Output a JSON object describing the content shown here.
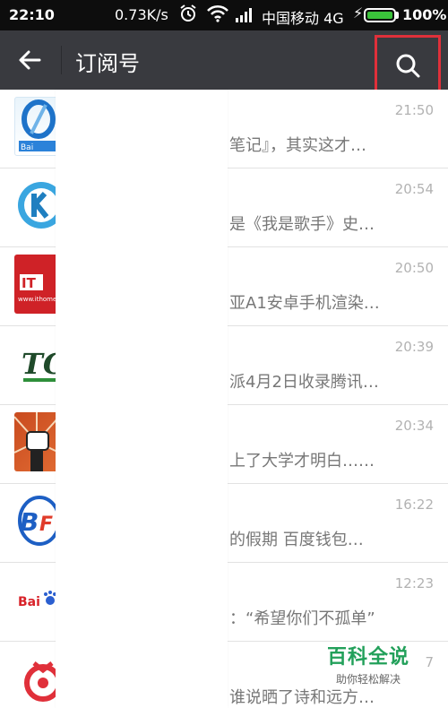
{
  "status_bar": {
    "time": "22:10",
    "speed": "0.73K/s",
    "carrier": "中国移动 4G",
    "battery": "100%"
  },
  "header": {
    "title": "订阅号"
  },
  "rows": [
    {
      "time": "21:50",
      "snippet": "笔记』，其实这才…",
      "avatar_icon": "baidu-blue-logo-icon"
    },
    {
      "time": "20:54",
      "snippet": "是《我是歌手》史…",
      "avatar_icon": "k-logo-icon"
    },
    {
      "time": "20:50",
      "snippet": "亚A1安卓手机渲染…",
      "avatar_icon": "ithome-logo-icon",
      "avatar_text": "IT",
      "avatar_sub": "www.ithome"
    },
    {
      "time": "20:39",
      "snippet": "派4月2日收录腾讯…",
      "avatar_icon": "tc-logo-icon",
      "avatar_text": "TC"
    },
    {
      "time": "20:34",
      "snippet": "上了大学才明白……",
      "avatar_icon": "fist-logo-icon"
    },
    {
      "time": "16:22",
      "snippet": "的假期  百度钱包…",
      "avatar_icon": "bf-logo-icon",
      "avatar_text": "BF"
    },
    {
      "time": "12:23",
      "snippet": "：“希望你们不孤单”",
      "avatar_icon": "baidu-paw-logo-icon",
      "avatar_text": "Bai"
    },
    {
      "time": "7",
      "snippet": "谁说晒了诗和远方…",
      "avatar_icon": "red-circle-logo-icon"
    }
  ],
  "watermark": {
    "title": "百科全说",
    "subtitle": "助你轻松解决"
  },
  "colors": {
    "header_bg": "#393a3f",
    "status_bg": "#0d0d0d",
    "highlight": "#e0303a",
    "watermark_green": "#22a05a"
  }
}
